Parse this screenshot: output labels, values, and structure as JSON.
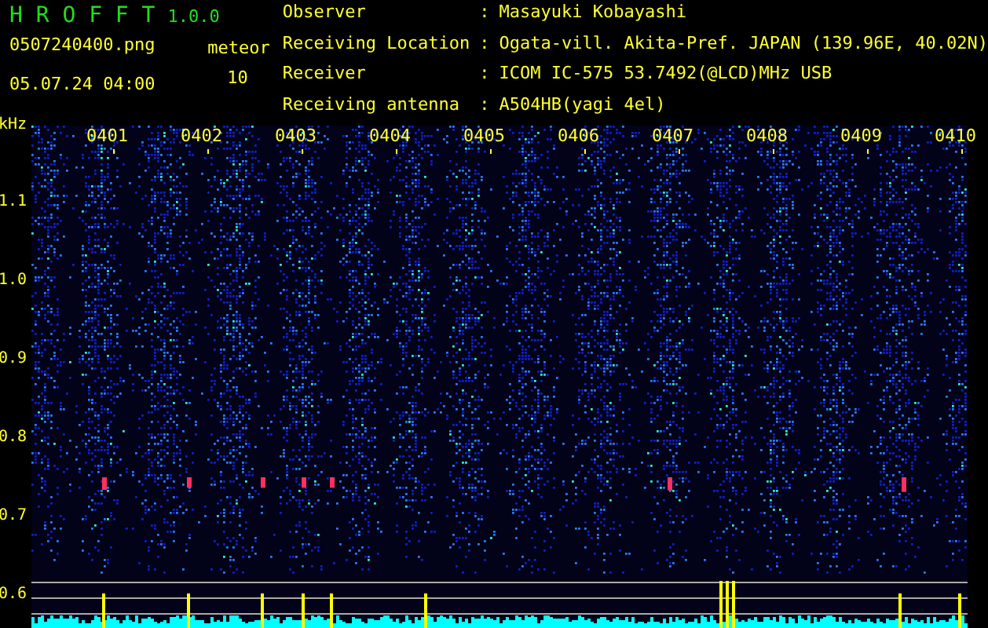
{
  "app": {
    "title": "H R O F F T",
    "version": "1.0.0"
  },
  "file": {
    "name": "0507240400.png",
    "datetime": "05.07.24 04:00"
  },
  "meteor": {
    "label": "meteor",
    "count": "10"
  },
  "info": [
    {
      "label": "Observer",
      "separator": ":",
      "value": "Masayuki Kobayashi"
    },
    {
      "label": "Receiving Location",
      "separator": ":",
      "value": "Ogata-vill. Akita-Pref. JAPAN (139.96E, 40.02N)"
    },
    {
      "label": "Receiver",
      "separator": ":",
      "value": "ICOM IC-575 53.7492(@LCD)MHz USB"
    },
    {
      "label": "Receiving antenna",
      "separator": ":",
      "value": "A504HB(yagi 4el)"
    }
  ],
  "axis": {
    "unit": "kHz",
    "ticks": [
      "1.1",
      "1.0",
      "0.9",
      "0.8",
      "0.7",
      "0.6"
    ]
  },
  "time_marks": [
    "0401",
    "0402",
    "0403",
    "0404",
    "0405",
    "0406",
    "0407",
    "0408",
    "0409",
    "0410"
  ]
}
